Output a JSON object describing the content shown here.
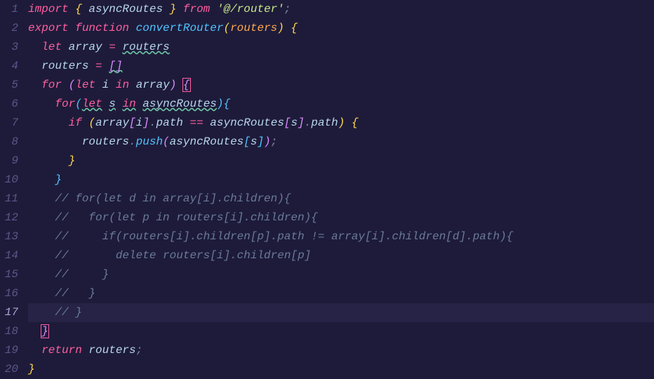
{
  "lineNumbers": [
    "1",
    "2",
    "3",
    "4",
    "5",
    "6",
    "7",
    "8",
    "9",
    "10",
    "11",
    "12",
    "13",
    "14",
    "15",
    "16",
    "17",
    "18",
    "19",
    "20"
  ],
  "activeLine": 17,
  "code": {
    "line1": {
      "import": "import",
      "lbrace": " { ",
      "asyncRoutes": "asyncRoutes",
      "rbrace": " } ",
      "from": "from",
      "str": " '@/router'",
      "semi": ";"
    },
    "line2": {
      "export": "export",
      "function": " function ",
      "fnName": "convertRouter",
      "lparen": "(",
      "param": "routers",
      "rparen": ")",
      "lbrace": " {"
    },
    "line3": {
      "indent": "  ",
      "let": "let",
      "sp": " ",
      "array": "array",
      "eq": " = ",
      "routers": "routers"
    },
    "line4": {
      "indent": "  ",
      "routers": "routers",
      "eq": " = ",
      "lbracket": "[",
      "rbracket": "]"
    },
    "line5": {
      "indent": "  ",
      "for": "for",
      "sp": " ",
      "lparen": "(",
      "let": "let",
      "sp2": " ",
      "i": "i",
      "sp3": " ",
      "in": "in",
      "sp4": " ",
      "array": "array",
      "rparen": ")",
      "sp5": " ",
      "lbrace": "{"
    },
    "line6": {
      "indent": "    ",
      "for": "for",
      "lparen": "(",
      "let": "let",
      "sp": " ",
      "s": "s",
      "sp2": " ",
      "in": "in",
      "sp3": " ",
      "asyncRoutes": "asyncRoutes",
      "rparen": ")",
      "lbrace": "{"
    },
    "line7": {
      "indent": "      ",
      "if": "if",
      "sp": " ",
      "lparen": "(",
      "array": "array",
      "lbracket1": "[",
      "i": "i",
      "rbracket1": "]",
      "dot1": ".",
      "path1": "path",
      "eq": " == ",
      "asyncRoutes": "asyncRoutes",
      "lbracket2": "[",
      "s": "s",
      "rbracket2": "]",
      "dot2": ".",
      "path2": "path",
      "rparen": ")",
      "sp2": " ",
      "lbrace": "{"
    },
    "line8": {
      "indent": "        ",
      "routers": "routers",
      "dot": ".",
      "push": "push",
      "lparen": "(",
      "asyncRoutes": "asyncRoutes",
      "lbracket": "[",
      "s": "s",
      "rbracket": "]",
      "rparen": ")",
      "semi": ";"
    },
    "line9": {
      "indent": "      ",
      "rbrace": "}"
    },
    "line10": {
      "indent": "    ",
      "rbrace": "}"
    },
    "line11": {
      "indent": "    ",
      "comment": "// for(let d in array[i].children){"
    },
    "line12": {
      "indent": "    ",
      "comment": "//   for(let p in routers[i].children){"
    },
    "line13": {
      "indent": "    ",
      "comment": "//     if(routers[i].children[p].path != array[i].children[d].path){"
    },
    "line14": {
      "indent": "    ",
      "comment": "//       delete routers[i].children[p]"
    },
    "line15": {
      "indent": "    ",
      "comment": "//     }"
    },
    "line16": {
      "indent": "    ",
      "comment": "//   }"
    },
    "line17": {
      "indent": "    ",
      "comment": "// }"
    },
    "line18": {
      "indent": "  ",
      "rbrace": "}"
    },
    "line19": {
      "indent": "  ",
      "return": "return",
      "sp": " ",
      "routers": "routers",
      "semi": ";"
    },
    "line20": {
      "rbrace": "}"
    }
  }
}
